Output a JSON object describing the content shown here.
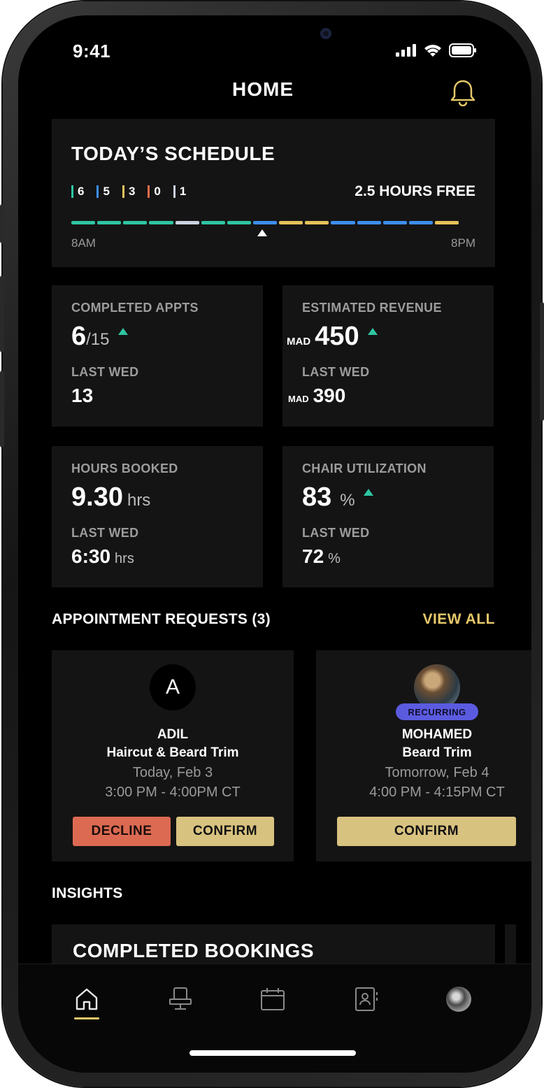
{
  "status_bar": {
    "time": "9:41"
  },
  "header": {
    "title": "HOME",
    "bell_icon": "bell-icon"
  },
  "schedule": {
    "title": "TODAY’S SCHEDULE",
    "free_time": "2.5 HOURS FREE",
    "start": "8AM",
    "end": "8PM",
    "legend": [
      {
        "count": "6",
        "color": "#2ec5a3"
      },
      {
        "count": "5",
        "color": "#3d8ef0"
      },
      {
        "count": "3",
        "color": "#e6c25a"
      },
      {
        "count": "0",
        "color": "#e26b4c"
      },
      {
        "count": "1",
        "color": "#c9d2e0"
      }
    ],
    "segments": [
      "#2ec5a3",
      "#2ec5a3",
      "#2ec5a3",
      "#2ec5a3",
      "#c9d2e0",
      "#2ec5a3",
      "#2ec5a3",
      "#3d8ef0",
      "#e6c25a",
      "#e6c25a",
      "#3d8ef0",
      "#3d8ef0",
      "#3d8ef0",
      "#3d8ef0",
      "#e6c25a"
    ]
  },
  "stats": {
    "completed": {
      "label": "COMPLETED APPTS",
      "value": "6",
      "of": "/15",
      "last_label": "LAST WED",
      "last_value": "13"
    },
    "revenue": {
      "label": "ESTIMATED REVENUE",
      "currency": "MAD",
      "value": "450",
      "last_label": "LAST WED",
      "last_currency": "MAD",
      "last_value": "390"
    },
    "hours": {
      "label": "HOURS BOOKED",
      "value": "9.30",
      "unit": "hrs",
      "last_label": "LAST WED",
      "last_value": "6:30",
      "last_unit": "hrs"
    },
    "utilization": {
      "label": "CHAIR UTILIZATION",
      "value": "83",
      "unit": "%",
      "last_label": "LAST WED",
      "last_value": "72",
      "last_unit": "%"
    }
  },
  "requests": {
    "title": "APPOINTMENT REQUESTS (3)",
    "view_all": "VIEW ALL",
    "items": [
      {
        "initial": "A",
        "name": "ADIL",
        "service": "Haircut & Beard Trim",
        "date": "Today, Feb 3",
        "time": "3:00 PM - 4:00PM CT",
        "decline": "DECLINE",
        "confirm": "CONFIRM"
      },
      {
        "badge": "RECURRING",
        "name": "MOHAMED",
        "service": "Beard Trim",
        "date": "Tomorrow, Feb 4",
        "time": "4:00 PM - 4:15PM CT",
        "confirm": "CONFIRM"
      }
    ]
  },
  "insights": {
    "title": "INSIGHTS",
    "card_title": "COMPLETED BOOKINGS"
  },
  "tabbar": {
    "items": [
      "home-icon",
      "chair-icon",
      "calendar-icon",
      "contacts-icon",
      "profile-avatar"
    ],
    "accent": "#e6c86a"
  }
}
